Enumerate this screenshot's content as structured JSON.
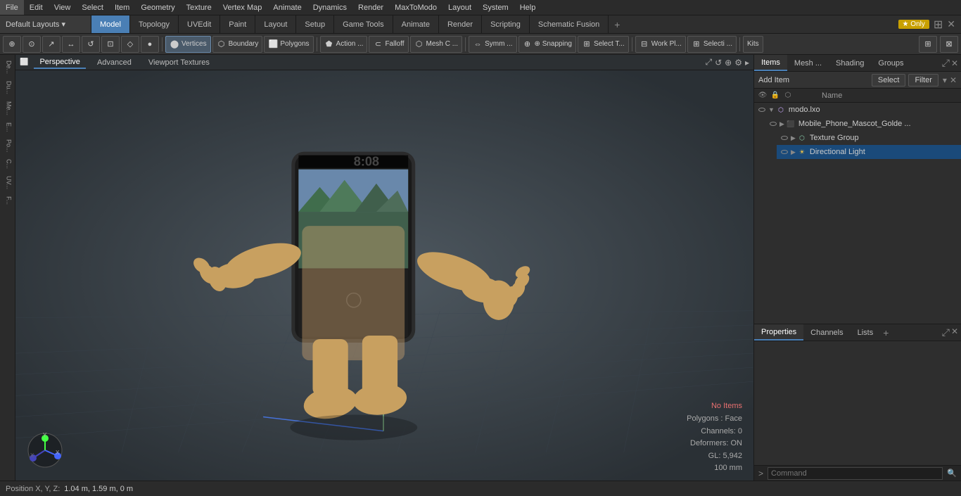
{
  "menu": {
    "items": [
      "File",
      "Edit",
      "View",
      "Select",
      "Item",
      "Geometry",
      "Texture",
      "Vertex Map",
      "Animate",
      "Dynamics",
      "Render",
      "MaxToModo",
      "Layout",
      "System",
      "Help"
    ]
  },
  "layout": {
    "dropdown_label": "Default Layouts ▾"
  },
  "tabs": {
    "items": [
      "Model",
      "Topology",
      "UVEdit",
      "Paint",
      "Layout",
      "Setup",
      "Game Tools",
      "Animate",
      "Render",
      "Scripting",
      "Schematic Fusion"
    ]
  },
  "tab_right": {
    "star_label": "★ Only",
    "plus_label": "+"
  },
  "toolbar": {
    "items": [
      {
        "label": "⊕",
        "name": "origin-tool"
      },
      {
        "label": "⊙",
        "name": "world-tool"
      },
      {
        "label": "⊿",
        "name": "selection-tool"
      },
      {
        "label": "↔",
        "name": "transform-tool"
      },
      {
        "label": "○",
        "name": "circle-tool"
      },
      {
        "label": "□",
        "name": "rect-tool"
      },
      {
        "label": "◇",
        "name": "diamond-tool"
      },
      {
        "label": "●",
        "name": "dot-tool"
      }
    ],
    "mode_btns": [
      "Vertices",
      "Boundary",
      "Polygons"
    ],
    "action_label": "Action ...",
    "falloff_label": "Falloff",
    "mesh_label": "Mesh C ...",
    "symm_label": "Symm ...",
    "snapping_label": "⊕ Snapping",
    "select_label": "Select T...",
    "workplane_label": "Work Pl...",
    "selecti_label": "Selecti ...",
    "kits_label": "Kits"
  },
  "viewport": {
    "tabs": [
      "Perspective",
      "Advanced",
      "Viewport Textures"
    ],
    "active_tab": "Perspective",
    "info": {
      "no_items": "No Items",
      "polygons": "Polygons : Face",
      "channels": "Channels: 0",
      "deformers": "Deformers: ON",
      "gl": "GL: 5,942",
      "units": "100 mm"
    }
  },
  "position_bar": {
    "label": "Position X, Y, Z:",
    "value": "1.04 m, 1.59 m, 0 m"
  },
  "right_panel": {
    "tabs": [
      "Items",
      "Mesh ...",
      "Shading",
      "Groups"
    ],
    "active_tab": "Items",
    "add_item_placeholder": "Add Item",
    "add_item_btn": "Select",
    "filter_btn": "Filter",
    "name_header": "Name",
    "items_list": [
      {
        "name": "modo.lxo",
        "type": "scene",
        "indent": 0,
        "expanded": true,
        "id": "root"
      },
      {
        "name": "Mobile_Phone_Mascot_Golde ...",
        "type": "mesh",
        "indent": 1,
        "expanded": false,
        "id": "mesh"
      },
      {
        "name": "Texture Group",
        "type": "group",
        "indent": 2,
        "expanded": false,
        "id": "texgroup"
      },
      {
        "name": "Directional Light",
        "type": "light",
        "indent": 2,
        "expanded": false,
        "id": "dirlight"
      }
    ]
  },
  "properties": {
    "tabs": [
      "Properties",
      "Channels",
      "Lists"
    ],
    "active_tab": "Properties",
    "plus_label": "+"
  },
  "command_bar": {
    "prompt_label": ">",
    "placeholder": "Command",
    "search_btn": "🔍"
  },
  "left_sidebar": {
    "items": [
      "De...",
      "Du...",
      "Me...",
      "E...",
      "Po...",
      "C...",
      "UV...",
      "F..."
    ]
  },
  "colors": {
    "active_tab_bg": "#4a7fb5",
    "selected_row_bg": "#1a4a7a",
    "toolbar_bg": "#333333",
    "viewport_bg": "#4a5055"
  }
}
